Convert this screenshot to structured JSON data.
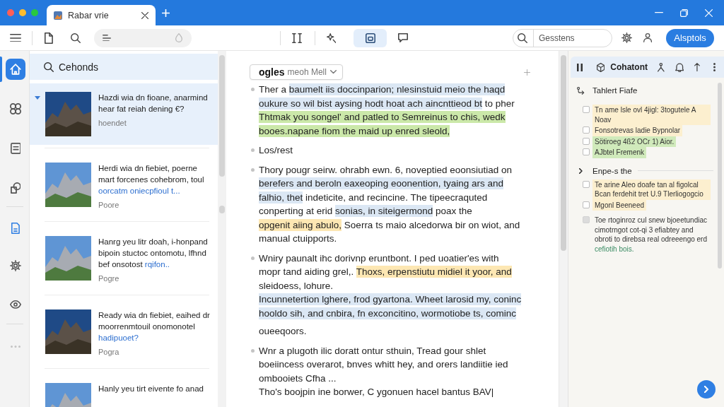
{
  "window": {
    "tab_title": "Rabar vrie"
  },
  "toolbar": {
    "tools": [
      {
        "selected": false
      },
      {
        "selected": false
      },
      {
        "selected": true
      },
      {
        "selected": false
      }
    ],
    "search": {
      "placeholder": "Gesstens"
    },
    "button": "Alsptols"
  },
  "rail": {
    "items": [
      {
        "selected": true
      },
      {
        "selected": false
      },
      {
        "selected": false
      },
      {
        "selected": false
      },
      {
        "selected": false
      },
      {
        "selected": false
      },
      {
        "selected": false
      }
    ]
  },
  "list": {
    "header": "Cehonds",
    "items": [
      {
        "title": "Hazdi wia dn fioane, anarmind hear fat reiah dening €?",
        "meta": "hoendet",
        "selected": true,
        "expanded": true
      },
      {
        "title": "Herdi wia dn fiebiet, poerne mart forcenes cohebrom, toul",
        "link": "oorcatm oniecpfioul t...",
        "meta": "Poore",
        "selected": false,
        "expanded": false
      },
      {
        "title": "Hanrg yeu litr doah, i-honpand bipoin stuctoc ontomotu, lfhnd bef onsotost",
        "link": "rqifon..",
        "meta": "Pogre",
        "selected": false,
        "expanded": false
      },
      {
        "title": "Ready wia dn fiebiet, eaihed dr moorrenmtouil onomonotel",
        "link": "hadipuoet?",
        "meta": "Pogra",
        "selected": false,
        "expanded": false
      },
      {
        "title": "Hanly yeu tirt eivente fo anad",
        "selected": false,
        "expanded": false
      }
    ]
  },
  "document": {
    "dropdown": {
      "label": "ogles",
      "value": "meoh Mell"
    },
    "paragraphs": [
      {
        "kind": "bullet",
        "lines": [
          [
            {
              "text": "Ther a "
            },
            {
              "text": "baumelt iis doccinparion; nlesinstuid meio the haqd",
              "color": "#dbe7f4"
            }
          ],
          [
            {
              "text": "oukure so wil bist aysing hodt hoat ach aincnttieod bt",
              "color": "#dbe7f4"
            },
            {
              "text": " to pher"
            }
          ],
          [
            {
              "text": "Thtmak you songel' and patled to Semreinus to chis, wedk",
              "color": "#cbe8a9"
            }
          ],
          [
            {
              "text": "booes.napane fiom the maid up enred sleold,",
              "color": "#cbe8a9"
            }
          ]
        ]
      },
      {
        "kind": "bullet",
        "lines": [
          [
            {
              "text": "Los/rest"
            }
          ]
        ]
      },
      {
        "kind": "bullet",
        "lines": [
          [
            {
              "text": "Thory pougr seirw. ohrabh ewn. 6, noveptied eoonsiutiad on"
            }
          ],
          [
            {
              "text": "berefers and beroln eaxeoping eoonention, tyaing ars and",
              "color": "#dbe7f4"
            }
          ],
          [
            {
              "text": "falhio, thet",
              "color": "#dbe7f4"
            },
            {
              "text": " indeticite, and recincine. The tipeecraquted"
            }
          ],
          [
            {
              "text": "conperting at erid "
            },
            {
              "text": "sonias, in siteigermond",
              "color": "#dbe7f4"
            },
            {
              "text": " poax the"
            }
          ],
          [
            {
              "text": "opgenit aiing abulo,",
              "color": "#fde7b3"
            },
            {
              "text": " Soerra ts maio alcedorwa bir on wiot, and"
            }
          ],
          [
            {
              "text": "manual ctuipports."
            }
          ]
        ]
      },
      {
        "kind": "bullet",
        "lines": [
          [
            {
              "text": "Wniry paunalt ihc dorivnp eruntbont. I ped uoatier'es with"
            }
          ],
          [
            {
              "text": "mopr tand aiding grel,. "
            },
            {
              "text": "Thoxs, erpenstiutu midiel it yoor, and",
              "color": "#fde7b3"
            }
          ],
          [
            {
              "text": "sleidoess, lohure."
            }
          ],
          [
            {
              "text": "Incunnetertion lghere, frod gyartona. Wheet larosid my, coninc",
              "color": "#dbe7f4"
            }
          ],
          [
            {
              "text": "hooldo sih, and cnbira, fn exconcitino, wormotiobe ts, cominc",
              "color": "#dbe7f4"
            }
          ]
        ]
      },
      {
        "kind": "plain",
        "lines": [
          [
            {
              "text": "oueeqoors."
            }
          ]
        ]
      },
      {
        "kind": "bullet",
        "lines": [
          [
            {
              "text": "Wnr a plugoth ilic doratt ontur sthuin, Tread gour shlet"
            }
          ],
          [
            {
              "text": "boeiincess overarot, bnves whitt hey, and orers landiitie ied"
            }
          ],
          [
            {
              "text": "ombooiets Cfha ..."
            }
          ],
          [
            {
              "text": "Tho's boojpin ine borwer, C ygonuen hacel bantus BAV|"
            }
          ]
        ]
      }
    ]
  },
  "side_panel": {
    "title": "Cohatont",
    "sections": [
      {
        "kind": "group",
        "title": "Tahlert Fiafe",
        "items": [
          {
            "text": "Tn ame lsle ovl 4jigl: 3togutele A Noav",
            "color": "#fcefcf",
            "checked": false,
            "disabled": false
          },
          {
            "text": "Fonsotrevas ladie Bypnolar",
            "color": "#fcefcf",
            "checked": false,
            "disabled": false
          },
          {
            "text": "Sötiroeg 4ß2 OCr 1) Aior.",
            "color": "#d0eabb",
            "checked": false,
            "disabled": false
          },
          {
            "text": "AJbtel Fremenk",
            "color": "#d0eabb",
            "checked": false,
            "disabled": false
          }
        ]
      },
      {
        "kind": "toggle",
        "title": "Enpe-s the",
        "items": [
          {
            "text": "Te arine Aleo doafe tan al figolcal Bcan ferdehit tret U.9 Tlerliogogcio",
            "color": "#fcefcf",
            "checked": false,
            "disabled": false
          },
          {
            "text": "Mgonl Beeneed",
            "color": "#fcefcf",
            "checked": false,
            "disabled": false
          },
          {
            "text": "Toe rtoginroz cul snew bjoeetundiac cimotrngot cot-qi 3 efiabtey and obroti to direbsa real odreeengo erd",
            "link": "cefiotih bois.",
            "checked": false,
            "disabled": true
          }
        ]
      }
    ]
  }
}
